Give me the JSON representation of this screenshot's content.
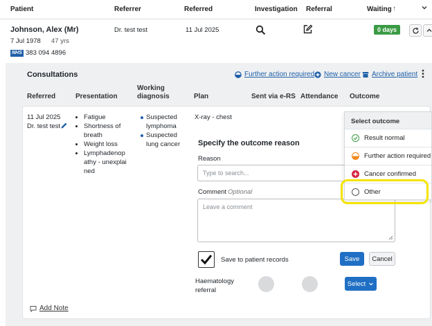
{
  "columns": {
    "patient": "Patient",
    "referrer": "Referrer",
    "referred": "Referred",
    "investigation": "Investigation",
    "referral": "Referral",
    "waiting": "Waiting",
    "sort_arrow": "↑"
  },
  "patient": {
    "name": "Johnson, Alex (Mr)",
    "dob": "7 Jul 1978",
    "age": "47 yrs",
    "nhs_badge": "NHS",
    "nhs_number": "383 094 4896",
    "referrer": "Dr. test test",
    "referred": "11 Jul 2025",
    "waiting_badge": "0 days"
  },
  "consultations": {
    "title": "Consultations",
    "actions": {
      "further_action": "Further action required",
      "new_cancer": "New cancer",
      "archive": "Archive patient"
    },
    "headers": {
      "referred": "Referred",
      "presentation": "Presentation",
      "working_diagnosis": "Working diagnosis",
      "plan": "Plan",
      "sent_via": "Sent via e-RS",
      "attendance": "Attendance",
      "outcome": "Outcome"
    },
    "row": {
      "date": "11 Jul 2025",
      "doctor": "Dr. test test",
      "presentation": [
        "Fatigue",
        "Shortness of breath",
        "Weight loss",
        "Lymphadenopathy - unexplained"
      ],
      "diagnosis": [
        "Suspected lymphoma",
        "Suspected lung cancer"
      ],
      "plan": "X-ray - chest"
    },
    "add_note": "Add Note"
  },
  "outcome_form": {
    "title": "Specify the outcome reason",
    "reason_label": "Reason",
    "reason_placeholder": "Type to search...",
    "comment_label": "Comment",
    "comment_optional": "Optional",
    "comment_placeholder": "Leave a comment",
    "save_records_label": "Save to patient records",
    "save_records_checked": true,
    "save_button": "Save",
    "cancel_button": "Cancel",
    "haematology_label_1": "Haematology",
    "haematology_label_2": "referral",
    "select_button": "Select"
  },
  "outcome_dropdown": {
    "header": "Select outcome",
    "options": [
      {
        "label": "Result normal",
        "color": "#3a9b44"
      },
      {
        "label": "Further action required",
        "color": "#f08a1c"
      },
      {
        "label": "Cancer confirmed",
        "color": "#d4213d"
      },
      {
        "label": "Other",
        "color": "#555555"
      }
    ],
    "highlight_color": "#f4e400"
  },
  "colors": {
    "brand_blue": "#1f5fa8",
    "waiting_green": "#3a9b44"
  }
}
